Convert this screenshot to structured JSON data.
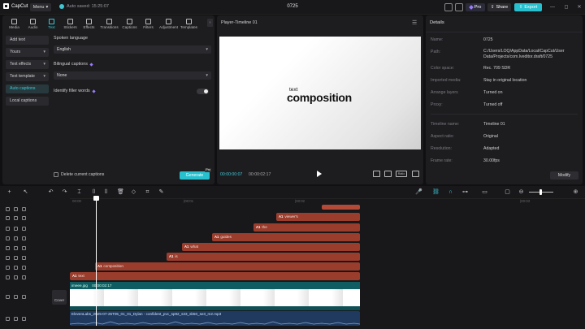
{
  "app": {
    "name": "CapCut",
    "menu_label": "Menu",
    "autosave": "Auto saved: 15:25:07",
    "project_title": "0725",
    "pro_label": "Pro",
    "share_label": "Share",
    "export_label": "Export",
    "window_controls": [
      "—",
      "◻",
      "✕"
    ]
  },
  "tabs": [
    {
      "label": "Media",
      "icon": "media-icon"
    },
    {
      "label": "Audio",
      "icon": "audio-icon"
    },
    {
      "label": "Text",
      "icon": "text-icon",
      "active": true
    },
    {
      "label": "Stickers",
      "icon": "stickers-icon"
    },
    {
      "label": "Effects",
      "icon": "effects-icon"
    },
    {
      "label": "Transitions",
      "icon": "transitions-icon"
    },
    {
      "label": "Captions",
      "icon": "captions-icon"
    },
    {
      "label": "Filters",
      "icon": "filters-icon"
    },
    {
      "label": "Adjustment",
      "icon": "adjustment-icon"
    },
    {
      "label": "Templates",
      "icon": "templates-icon"
    }
  ],
  "side_nav": [
    {
      "label": "Add text"
    },
    {
      "label": "Yours",
      "dropdown": true
    },
    {
      "label": "Text effects",
      "dropdown": true
    },
    {
      "label": "Text template",
      "dropdown": true
    },
    {
      "label": "Auto captions",
      "active": true
    },
    {
      "label": "Local captions"
    }
  ],
  "captions": {
    "spoken_language_label": "Spoken language",
    "spoken_language_value": "English",
    "bilingual_label": "Bilingual captions",
    "bilingual_value": "None",
    "filler_label": "Identify filler words",
    "delete_label": "Delete current captions",
    "generate_label": "Generate",
    "generate_badge": "Pro"
  },
  "player": {
    "title": "Player-Timeline 01",
    "canvas_small_text": "text",
    "canvas_big_text": "composition",
    "current_time": "00:00:00:07",
    "duration": "00:00:02:17",
    "ratio_label": "Ratio",
    "menu_glyph": "☰"
  },
  "details": {
    "title": "Details",
    "rows": [
      {
        "label": "Name:",
        "value": "0725"
      },
      {
        "label": "Path:",
        "value": "C:/Users/LOQ/AppData/Local/CapCut/User Data/Projects/com.lveditor.draft/0725"
      },
      {
        "label": "Color space:",
        "value": "Rec. 709 SDR"
      },
      {
        "label": "Imported media:",
        "value": "Stay in original location"
      },
      {
        "label": "Arrange layers",
        "value": "Turned on"
      },
      {
        "label": "Proxy:",
        "value": "Turned off"
      },
      {
        "label": "Timeline name:",
        "value": "Timeline 01"
      },
      {
        "label": "Aspect ratio:",
        "value": "Original"
      },
      {
        "label": "Resolution:",
        "value": "Adapted"
      },
      {
        "label": "Frame rate:",
        "value": "30.00fps"
      }
    ],
    "modify_label": "Modify"
  },
  "timeline": {
    "ruler": [
      "00:00",
      "|00:01",
      "|00:02",
      "|00:03"
    ],
    "text_clips": [
      {
        "badge": "",
        "label": ""
      },
      {
        "badge": "A1",
        "label": "viewer's"
      },
      {
        "badge": "A1",
        "label": "the"
      },
      {
        "badge": "A1",
        "label": "guides"
      },
      {
        "badge": "A1",
        "label": "what"
      },
      {
        "badge": "A1",
        "label": "is"
      },
      {
        "badge": "A1",
        "label": "composition"
      },
      {
        "badge": "A1",
        "label": "text"
      }
    ],
    "video_clip_label": "imeee.jpg",
    "video_clip_duration": "00:00:02:17",
    "cover_label": "Cover",
    "audio_clip_label": "ElevenLabs_2025-07-25T05_01_01_Dylan - confident_pvc_sp92_s33_sb50_se3_m2.mp3"
  }
}
